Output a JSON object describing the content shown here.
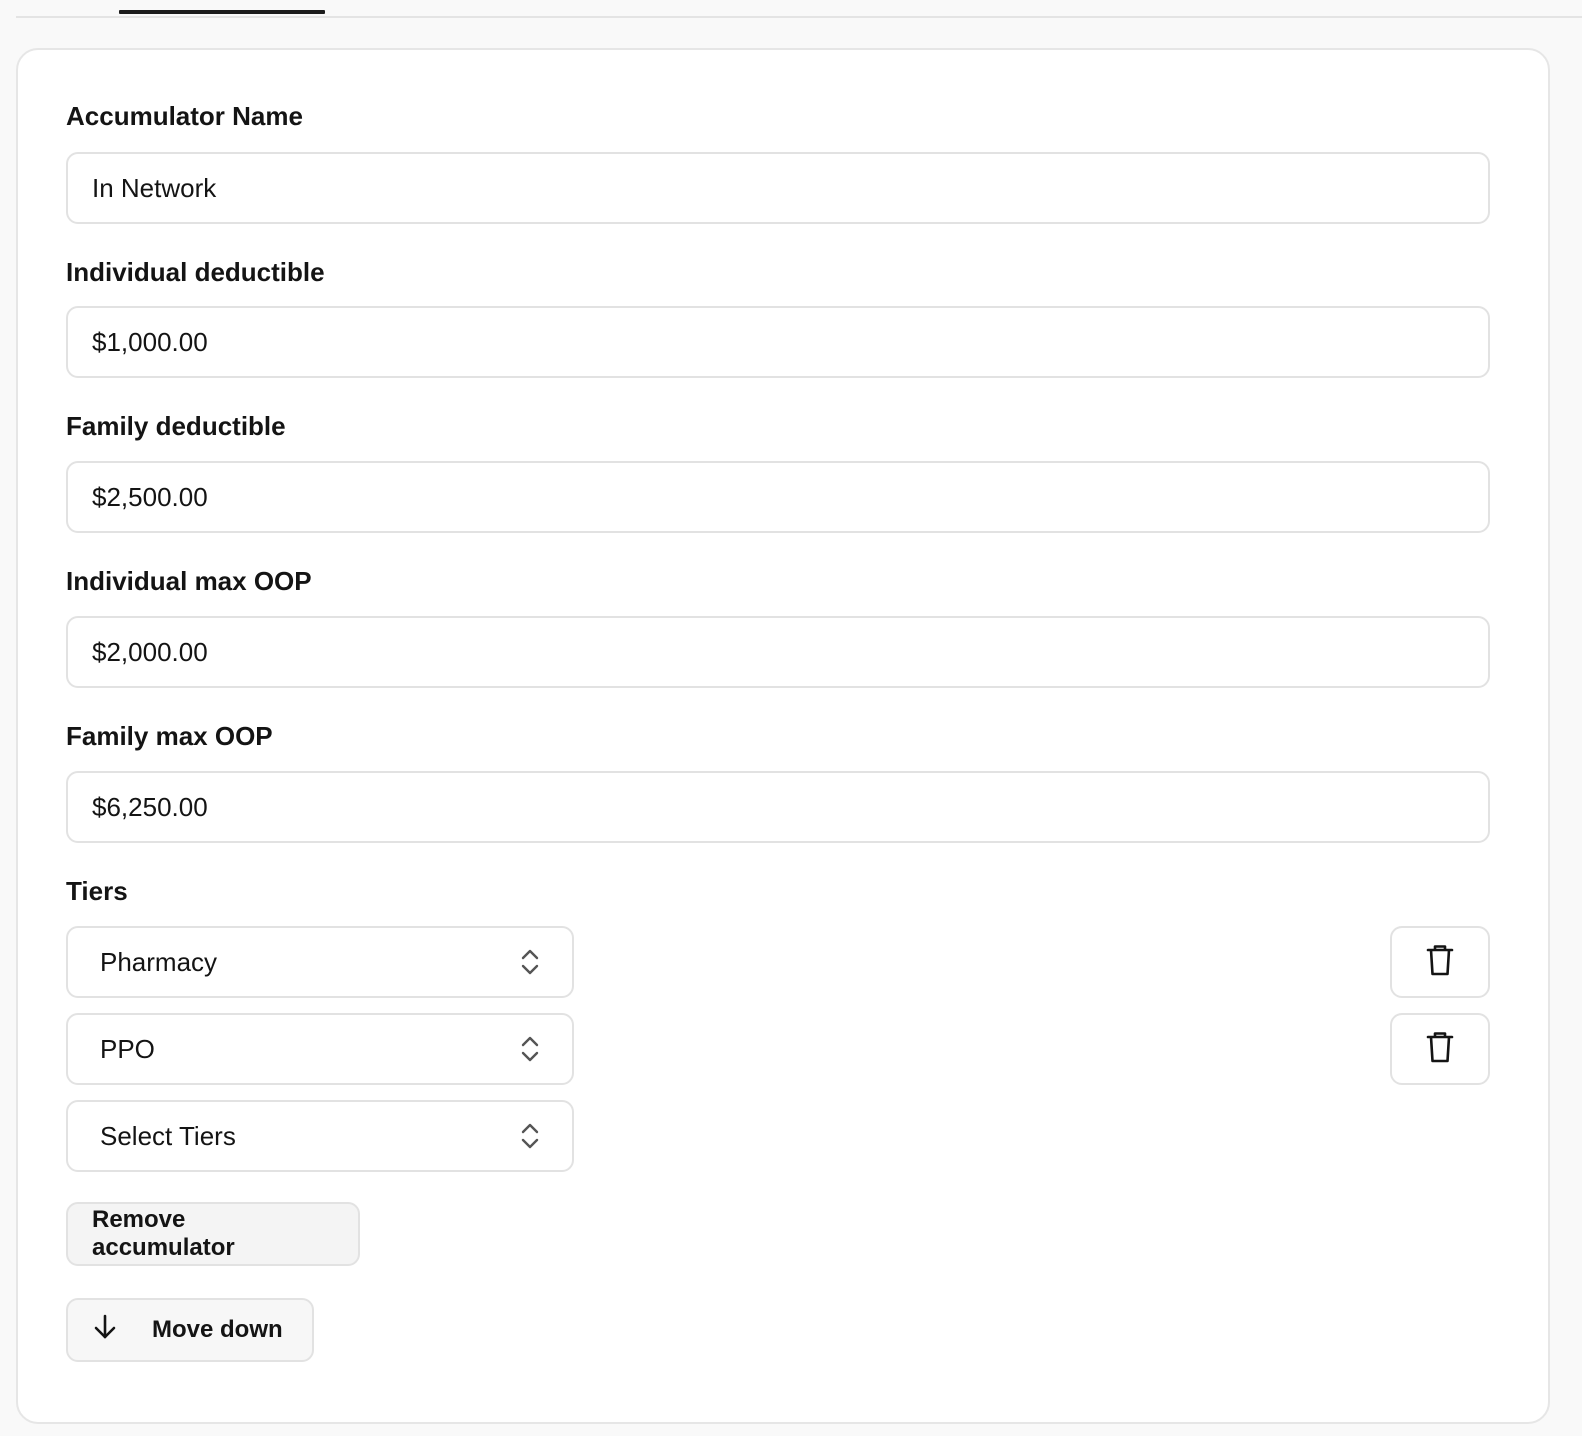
{
  "form": {
    "fields": [
      {
        "label": "Accumulator Name",
        "value": "In Network"
      },
      {
        "label": "Individual deductible",
        "value": "$1,000.00"
      },
      {
        "label": "Family deductible",
        "value": "$2,500.00"
      },
      {
        "label": "Individual max OOP",
        "value": "$2,000.00"
      },
      {
        "label": "Family max OOP",
        "value": "$6,250.00"
      }
    ],
    "tiers": {
      "label": "Tiers",
      "selected": [
        "Pharmacy",
        "PPO"
      ],
      "new_placeholder": "Select Tiers"
    },
    "buttons": {
      "remove_accumulator": "Remove accumulator",
      "move_down": "Move down"
    }
  },
  "icons": {
    "select": "chevron-up-down-icon",
    "delete": "trash-icon",
    "move": "arrow-down-icon"
  }
}
